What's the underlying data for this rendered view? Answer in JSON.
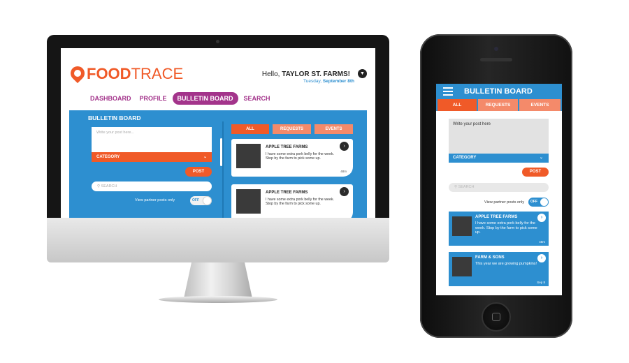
{
  "brand": {
    "name_part1": "FOOD",
    "name_part2": "TRACE",
    "accent": "#f05a28",
    "primary_blue": "#2d8fd0",
    "nav_purple": "#a3348b"
  },
  "desktop": {
    "greeting_prefix": "Hello, ",
    "user_name": "TAYLOR ST. FARMS!",
    "date_day": "Tuesday, ",
    "date_text": "September 8th",
    "nav": [
      {
        "label": "DASHBOARD"
      },
      {
        "label": "PROFILE"
      },
      {
        "label": "BULLETIN BOARD"
      },
      {
        "label": "SEARCH"
      }
    ],
    "panel_title": "BULLETIN BOARD",
    "post_placeholder": "Write your post here...",
    "category_label": "CATEGORY",
    "post_button": "POST",
    "search_placeholder": "SEARCH",
    "partner_label": "View partner posts only",
    "toggle_label": "OFF",
    "filters": {
      "all": "ALL",
      "requests": "REQUESTS",
      "events": "EVENTS"
    },
    "posts": [
      {
        "name": "APPLE TREE FARMS",
        "body": "I have some extra pork belly for the week. Stop by the farm to pick some up.",
        "time": "48m"
      },
      {
        "name": "APPLE TREE FARMS",
        "body": "I have some extra pork belly for the week. Stop by the farm to pick some up.",
        "time": ""
      }
    ]
  },
  "mobile": {
    "title": "BULLETIN BOARD",
    "tabs": {
      "all": "ALL",
      "requests": "REQUESTS",
      "events": "EVENTS"
    },
    "post_placeholder": "Write your post here",
    "category_label": "CATEGORY",
    "post_button": "POST",
    "search_placeholder": "SEARCH",
    "partner_label": "View partner posts only",
    "toggle_label": "OFF",
    "posts": [
      {
        "name": "APPLE TREE FARMS",
        "body": "I have some extra pork belly for the week. Stop by the farm to pick some up.",
        "time": "48m"
      },
      {
        "name": "FARM & SONS",
        "body": "This year we are growing pumpkins!",
        "time": "Sep 8"
      }
    ]
  }
}
